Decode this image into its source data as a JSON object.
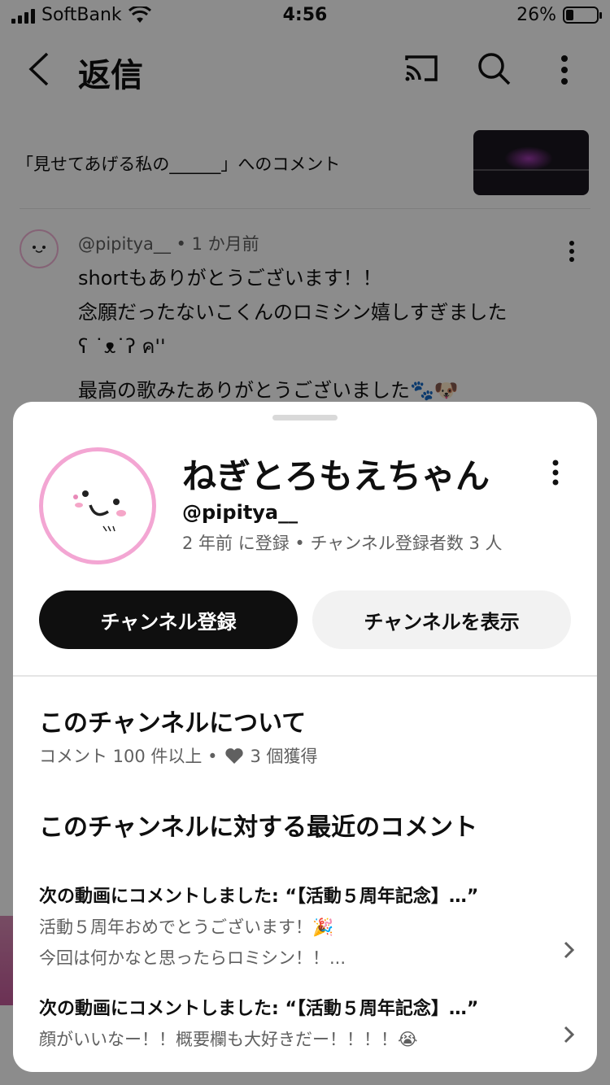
{
  "status_bar": {
    "carrier": "SoftBank",
    "time": "4:56",
    "battery": "26%",
    "battery_level": 0.26
  },
  "header": {
    "title": "返信",
    "icons": [
      "back-icon",
      "cast-icon",
      "search-icon",
      "more-vert-icon"
    ]
  },
  "video_ref": {
    "text": "「見せてあげる私の______」へのコメント"
  },
  "comment": {
    "meta": "@pipitya__ • 1 か月前",
    "lines": [
      "shortもありがとうございます！！",
      "念願だったないこくんのロミシン嬉しすぎました",
      "ʕ ˙ᴥ˙ʔ ค''",
      "最高の歌みたありがとうございました🐾🐶"
    ]
  },
  "channel": {
    "name": "ねぎとろもえちゃん",
    "handle": "@pipitya__",
    "subline": "2 年前 に登録 • チャンネル登録者数 3 人",
    "subscribe_label": "チャンネル登録",
    "view_label": "チャンネルを表示"
  },
  "about": {
    "title": "このチャンネルについて",
    "comments_count": "コメント 100 件以上 •",
    "likes": "3 個獲得"
  },
  "recent": {
    "title": "このチャンネルに対する最近のコメント",
    "items": [
      {
        "head": "次の動画にコメントしました: “【活動５周年記念】…”",
        "lines": [
          "活動５周年おめでとうございます！🎉",
          "今回は何かなと思ったらロミシン！！..."
        ]
      },
      {
        "head": "次の動画にコメントしました: “【活動５周年記念】…”",
        "lines": [
          "顔がいいなー！！概要欄も大好きだー！！！！😭"
        ]
      }
    ]
  }
}
